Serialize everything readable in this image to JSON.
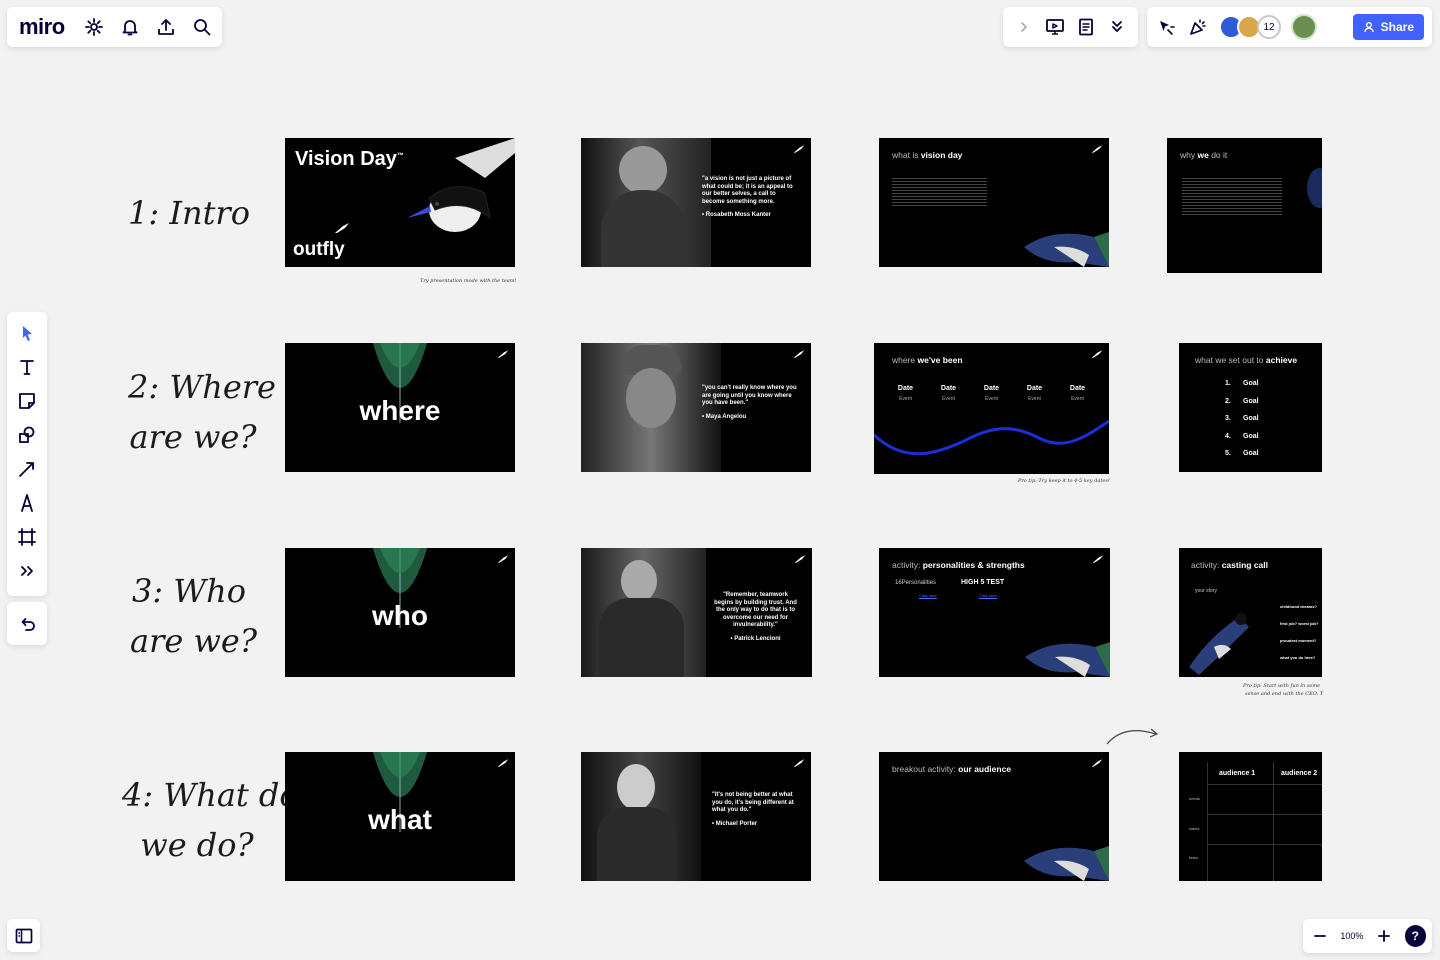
{
  "app": {
    "logo": "miro"
  },
  "toolbar": {
    "share_label": "Share",
    "collaborator_count": "12"
  },
  "zoom": {
    "level": "100%",
    "help": "?"
  },
  "rows": [
    {
      "label_line1": "1: Intro",
      "label_line2": ""
    },
    {
      "label_line1": "2: Where",
      "label_line2": "are we?"
    },
    {
      "label_line1": "3: Who",
      "label_line2": "are we?"
    },
    {
      "label_line1": "4: What do",
      "label_line2": "we do?"
    }
  ],
  "slides": {
    "s11": {
      "title": "Vision Day",
      "tm": "™",
      "brand": "outfly"
    },
    "s12": {
      "quote": "\"a vision is not just a picture of what could be; it is an appeal to our better selves, a call to become something more.",
      "author": "•   Rosabeth Moss Kanter"
    },
    "s13": {
      "title_prefix": "what is ",
      "title_bold": "vision day"
    },
    "s14": {
      "title_prefix": "why ",
      "title_bold": "we",
      "title_suffix": " do it"
    },
    "s21": {
      "word": "where"
    },
    "s22": {
      "quote": "\"you can't really know where you are going until you know where you have been.\"",
      "author": "•   Maya Angelou"
    },
    "s23": {
      "title_prefix": "where ",
      "title_bold": "we've been",
      "dates": [
        {
          "d": "Date",
          "e": "Event"
        },
        {
          "d": "Date",
          "e": "Event"
        },
        {
          "d": "Date",
          "e": "Event"
        },
        {
          "d": "Date",
          "e": "Event"
        },
        {
          "d": "Date",
          "e": "Event"
        }
      ]
    },
    "s24": {
      "title_prefix": "what we set out to ",
      "title_bold": "achieve",
      "goals": [
        {
          "n": "1.",
          "t": "Goal"
        },
        {
          "n": "2.",
          "t": "Goal"
        },
        {
          "n": "3.",
          "t": "Goal"
        },
        {
          "n": "4.",
          "t": "Goal"
        },
        {
          "n": "5.",
          "t": "Goal"
        }
      ]
    },
    "s31": {
      "word": "who"
    },
    "s32": {
      "quote": "\"Remember, teamwork begins by building trust. And the only way to do that is to overcome our need for invulnerability.\"",
      "author": "•   Patrick Lencioni"
    },
    "s33": {
      "title_prefix": "activity: ",
      "title_bold": "personalities & strengths",
      "logo1": "16Personalities",
      "logo2": "HIGH 5 TEST",
      "link1": "Click here",
      "link2": "Click here"
    },
    "s34": {
      "title_prefix": "activity: ",
      "title_bold": "casting call",
      "sub": "your story",
      "questions": [
        "childhood dreams?",
        "first job? worst job?",
        "proudest moment?",
        "what you do here?"
      ]
    },
    "s41": {
      "word": "what"
    },
    "s42": {
      "quote": "\"It's not being better at what you do, it's being different at what you do.\"",
      "author": "•   Michael Porter"
    },
    "s43": {
      "title_prefix": "breakout activity: ",
      "title_bold": "our audience"
    },
    "s44": {
      "col1": "audience 1",
      "col2": "audience 2",
      "rows": [
        "needs",
        "wants",
        "fears"
      ]
    }
  },
  "notes": {
    "n1": "Try presentation mode with the team!",
    "n2": "Pro tip: Try keep it to 4-5 key dates!",
    "n3": "Pro tip: Start with fun in some",
    "n4": "sense and end with the CEO. T"
  }
}
